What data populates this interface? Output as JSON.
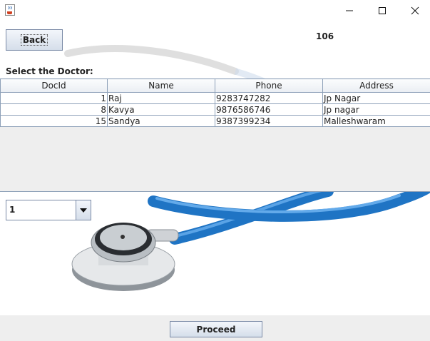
{
  "window": {
    "app_icon": "java-cup-icon",
    "controls": [
      "minimize-icon",
      "maximize-icon",
      "close-icon"
    ]
  },
  "toolbar": {
    "back_label": "Back",
    "count": "106"
  },
  "heading": "Select the Doctor:",
  "table": {
    "columns": [
      "DocId",
      "Name",
      "Phone",
      "Address"
    ],
    "rows": [
      [
        "1",
        "Raj",
        "9283747282",
        "Jp Nagar"
      ],
      [
        "8",
        "Kavya",
        "9876586746",
        "Jp nagar"
      ],
      [
        "15",
        "Sandya",
        "9387399234",
        "Malleshwaram"
      ]
    ]
  },
  "combo": {
    "selected": "1"
  },
  "footer": {
    "proceed_label": "Proceed"
  },
  "colors": {
    "tube_blue": "#1f74c4",
    "border": "#8da0b8",
    "panel": "#eeeeee"
  }
}
